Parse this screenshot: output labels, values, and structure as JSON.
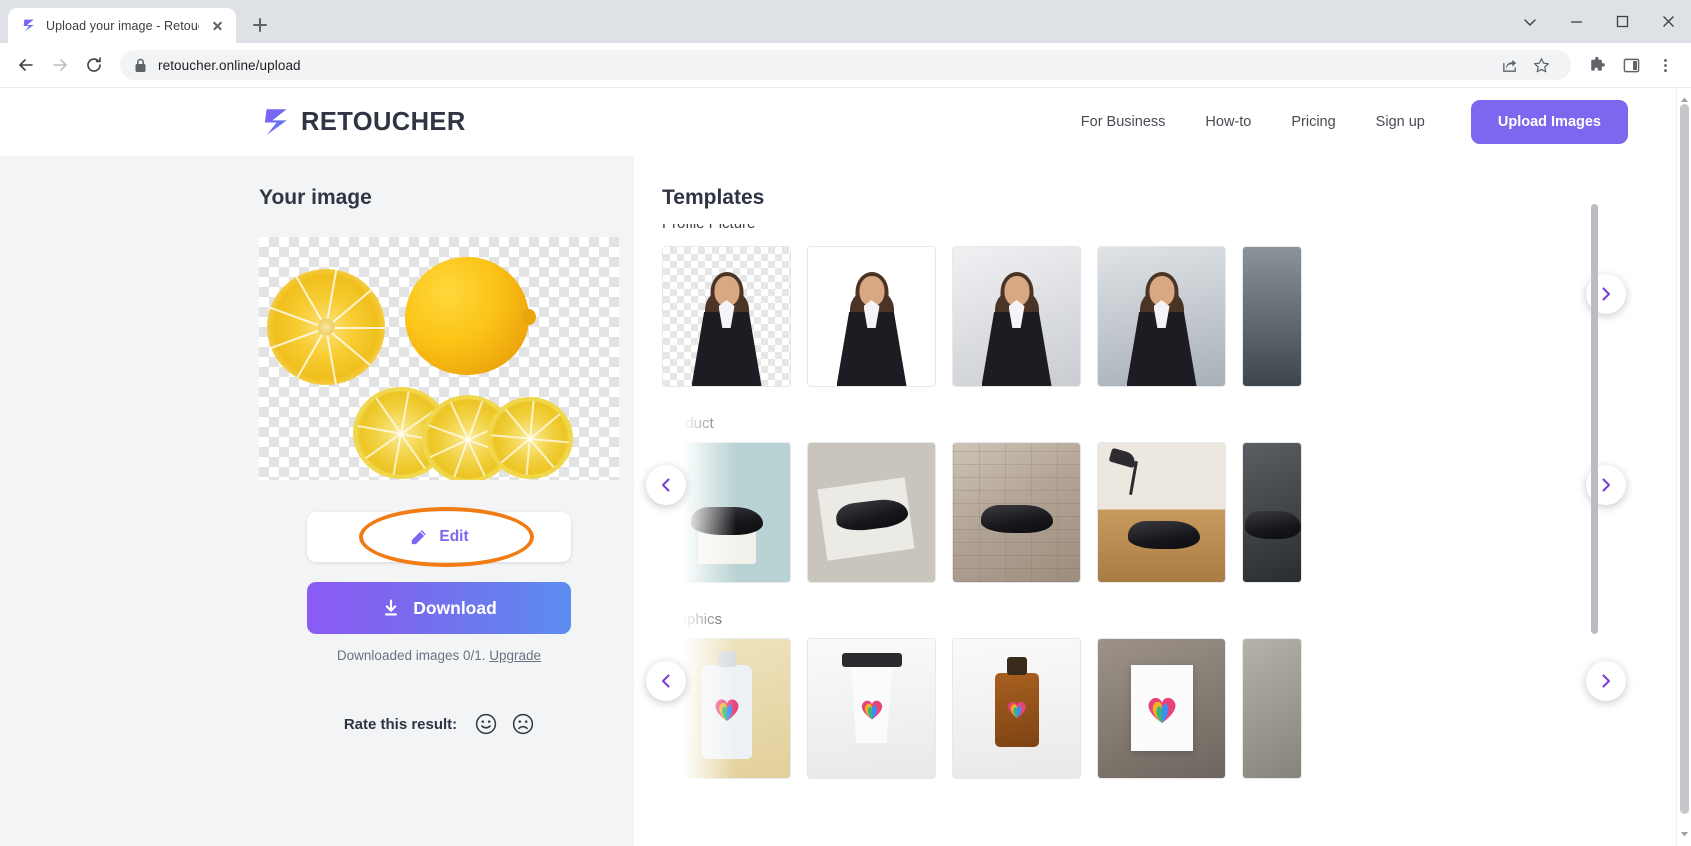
{
  "browser": {
    "tab": {
      "title": "Upload your image - Retoucher.O",
      "favicon_icon": "retoucher-logo-icon",
      "close_icon": "close-icon"
    },
    "new_tab_icon": "plus-icon",
    "window_controls": [
      "minimize-icon",
      "maximize-icon",
      "close-icon"
    ],
    "profile_icon": "caret-down-icon",
    "nav": {
      "back_icon": "arrow-left-icon",
      "forward_icon": "arrow-right-icon",
      "reload_icon": "reload-icon"
    },
    "omnibox": {
      "lock_icon": "lock-icon",
      "url": "retoucher.online/upload",
      "share_icon": "share-icon",
      "bookmark_icon": "star-icon"
    },
    "toolbar_right": {
      "extensions_icon": "puzzle-icon",
      "sidepanel_icon": "side-panel-icon",
      "menu_icon": "kebab-menu-icon"
    }
  },
  "site": {
    "logo": {
      "text": "RETOUCHER",
      "icon": "retoucher-logo-icon"
    },
    "nav_links": [
      "For Business",
      "How-to",
      "Pricing",
      "Sign up"
    ],
    "upload_button": "Upload Images"
  },
  "left_panel": {
    "title": "Your image",
    "image_alt": "lemons-cutout-image",
    "edit_button": {
      "label": "Edit",
      "icon": "pencil-icon"
    },
    "download_button": {
      "label": "Download",
      "icon": "download-icon"
    },
    "downloaded_note": {
      "text": "Downloaded images 0/1.",
      "link": "Upgrade"
    },
    "rate": {
      "label": "Rate this result:",
      "happy_icon": "smiley-happy-icon",
      "sad_icon": "smiley-sad-icon"
    }
  },
  "templates": {
    "title": "Templates",
    "next_icon": "chevron-right-icon",
    "prev_icon": "chevron-left-icon",
    "categories": [
      {
        "name": "Profile Picture",
        "clipped": true,
        "tiles": [
          {
            "name": "transparent-checkerboard",
            "style": "checker"
          },
          {
            "name": "white-background",
            "style": "white"
          },
          {
            "name": "light-gray-gradient",
            "style": "grad1"
          },
          {
            "name": "blue-gray-gradient",
            "style": "grad2"
          },
          {
            "name": "dark-gradient",
            "style": "grad3"
          }
        ]
      },
      {
        "name": "Product",
        "clipped": false,
        "tiles": [
          {
            "name": "mint-pedestal-scene",
            "style": "mint"
          },
          {
            "name": "beige-card-scene",
            "style": "beige"
          },
          {
            "name": "brick-wall-scene",
            "style": "brick"
          },
          {
            "name": "wood-floor-lamp-scene",
            "style": "wood"
          },
          {
            "name": "dark-studio-scene",
            "style": "dark"
          }
        ]
      },
      {
        "name": "Graphics",
        "clipped": false,
        "tiles": [
          {
            "name": "cream-bottle-mockup",
            "style": "cream"
          },
          {
            "name": "coffee-cup-mockup",
            "style": "cup"
          },
          {
            "name": "amber-dropper-mockup",
            "style": "amber"
          },
          {
            "name": "wall-poster-mockup",
            "style": "poster"
          },
          {
            "name": "stone-surface-mockup",
            "style": "stone"
          }
        ]
      }
    ]
  },
  "colors": {
    "brand_purple": "#7b68ee",
    "brand_blue": "#5b8def",
    "highlight_orange": "#f07c13",
    "text_dark": "#2f3542"
  }
}
